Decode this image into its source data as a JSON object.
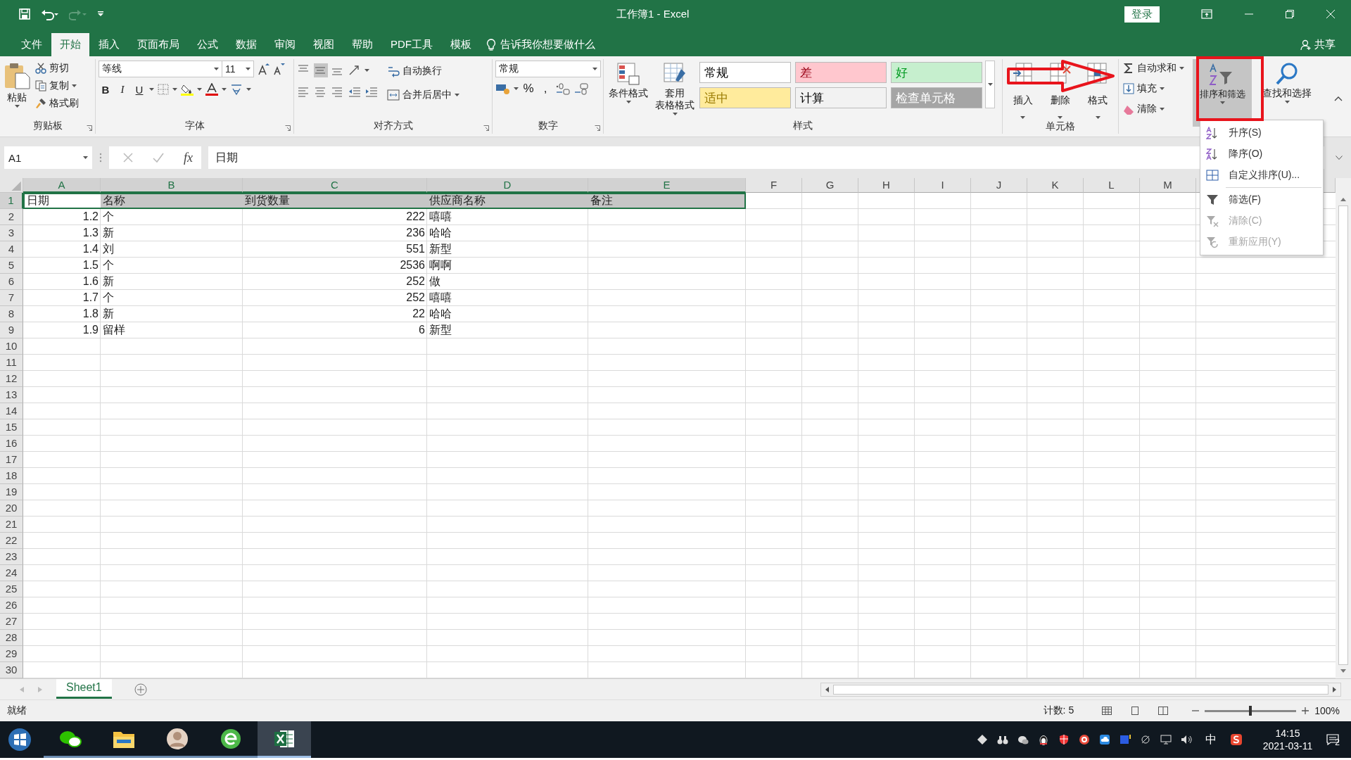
{
  "window": {
    "title": "工作簿1 - Excel",
    "login": "登录",
    "share": "共享"
  },
  "ribbon_tabs": [
    {
      "label": "文件",
      "selected": false
    },
    {
      "label": "开始",
      "selected": true
    },
    {
      "label": "插入",
      "selected": false
    },
    {
      "label": "页面布局",
      "selected": false
    },
    {
      "label": "公式",
      "selected": false
    },
    {
      "label": "数据",
      "selected": false
    },
    {
      "label": "审阅",
      "selected": false
    },
    {
      "label": "视图",
      "selected": false
    },
    {
      "label": "帮助",
      "selected": false
    },
    {
      "label": "PDF工具",
      "selected": false
    },
    {
      "label": "模板",
      "selected": false
    }
  ],
  "tell_me": "告诉我你想要做什么",
  "ribbon": {
    "clipboard": {
      "label": "剪贴板",
      "paste": "粘贴",
      "cut": "剪切",
      "copy": "复制",
      "format_painter": "格式刷"
    },
    "font": {
      "label": "字体",
      "font_name": "等线",
      "font_size": "11",
      "bold": "B",
      "italic": "I",
      "underline": "U"
    },
    "alignment": {
      "label": "对齐方式",
      "wrap_text": "自动换行",
      "merge_center": "合并后居中"
    },
    "number": {
      "label": "数字",
      "format": "常规",
      "percent": "%",
      "comma": ","
    },
    "styles": {
      "label": "样式",
      "conditional_formatting": "条件格式",
      "format_as_table": [
        "套用",
        "表格格式"
      ],
      "cell_styles": [
        {
          "label": "常规",
          "color": "#ffffff"
        },
        {
          "label": "差",
          "color": "#ffc7ce"
        },
        {
          "label": "好",
          "color": "#c6efce"
        },
        {
          "label": "适中",
          "color": "#ffeb9c"
        },
        {
          "label": "计算",
          "color": "#f2f2f2"
        },
        {
          "label": "检查单元格",
          "color": "#a5a5a5"
        }
      ]
    },
    "cells": {
      "label": "单元格",
      "insert": "插入",
      "delete": "删除",
      "format": "格式"
    },
    "editing": {
      "autosum": "自动求和",
      "fill": "填充",
      "clear": "清除",
      "sort_filter": {
        "label": "排序和筛选",
        "selected": true
      },
      "find_select": "查找和选择"
    }
  },
  "formula_bar": {
    "name_box": "A1",
    "fx": "fx",
    "formula": "日期"
  },
  "sheet": {
    "columns": [
      {
        "label": "A",
        "selected": true
      },
      {
        "label": "B",
        "selected": true
      },
      {
        "label": "C",
        "selected": true
      },
      {
        "label": "D",
        "selected": true
      },
      {
        "label": "E",
        "selected": true
      },
      {
        "label": "F",
        "selected": false
      },
      {
        "label": "G",
        "selected": false
      },
      {
        "label": "H",
        "selected": false
      },
      {
        "label": "I",
        "selected": false
      },
      {
        "label": "J",
        "selected": false
      },
      {
        "label": "K",
        "selected": false
      },
      {
        "label": "L",
        "selected": false
      },
      {
        "label": "M",
        "selected": false
      }
    ],
    "rows": [
      {
        "number": "1",
        "selected": true,
        "cells": [
          {
            "text": "日期",
            "kind": "text"
          },
          {
            "text": "名称",
            "kind": "text"
          },
          {
            "text": "到货数量",
            "kind": "text"
          },
          {
            "text": "供应商名称",
            "kind": "text"
          },
          {
            "text": "备注",
            "kind": "text"
          }
        ]
      },
      {
        "number": "2",
        "selected": false,
        "cells": [
          {
            "text": "1.2",
            "kind": "number"
          },
          {
            "text": "个",
            "kind": "text"
          },
          {
            "text": "222",
            "kind": "number"
          },
          {
            "text": "嘻嘻",
            "kind": "text"
          }
        ]
      },
      {
        "number": "3",
        "selected": false,
        "cells": [
          {
            "text": "1.3",
            "kind": "number"
          },
          {
            "text": "新",
            "kind": "text"
          },
          {
            "text": "236",
            "kind": "number"
          },
          {
            "text": "哈哈",
            "kind": "text"
          }
        ]
      },
      {
        "number": "4",
        "selected": false,
        "cells": [
          {
            "text": "1.4",
            "kind": "number"
          },
          {
            "text": "刘",
            "kind": "text"
          },
          {
            "text": "551",
            "kind": "number"
          },
          {
            "text": "新型",
            "kind": "text"
          }
        ]
      },
      {
        "number": "5",
        "selected": false,
        "cells": [
          {
            "text": "1.5",
            "kind": "number"
          },
          {
            "text": "个",
            "kind": "text"
          },
          {
            "text": "2536",
            "kind": "number"
          },
          {
            "text": "啊啊",
            "kind": "text"
          }
        ]
      },
      {
        "number": "6",
        "selected": false,
        "cells": [
          {
            "text": "1.6",
            "kind": "number"
          },
          {
            "text": "新",
            "kind": "text"
          },
          {
            "text": "252",
            "kind": "number"
          },
          {
            "text": "做",
            "kind": "text"
          }
        ]
      },
      {
        "number": "7",
        "selected": false,
        "cells": [
          {
            "text": "1.7",
            "kind": "number"
          },
          {
            "text": "个",
            "kind": "text"
          },
          {
            "text": "252",
            "kind": "number"
          },
          {
            "text": "嘻嘻",
            "kind": "text"
          }
        ]
      },
      {
        "number": "8",
        "selected": false,
        "cells": [
          {
            "text": "1.8",
            "kind": "number"
          },
          {
            "text": "新",
            "kind": "text"
          },
          {
            "text": "22",
            "kind": "number"
          },
          {
            "text": "哈哈",
            "kind": "text"
          }
        ]
      },
      {
        "number": "9",
        "selected": false,
        "cells": [
          {
            "text": "1.9",
            "kind": "number"
          },
          {
            "text": "留样",
            "kind": "text"
          },
          {
            "text": "6",
            "kind": "number"
          },
          {
            "text": "新型",
            "kind": "text"
          }
        ]
      },
      {
        "number": "10",
        "selected": false,
        "cells": []
      },
      {
        "number": "11",
        "selected": false,
        "cells": []
      },
      {
        "number": "12",
        "selected": false,
        "cells": []
      },
      {
        "number": "13",
        "selected": false,
        "cells": []
      },
      {
        "number": "14",
        "selected": false,
        "cells": []
      },
      {
        "number": "15",
        "selected": false,
        "cells": []
      },
      {
        "number": "16",
        "selected": false,
        "cells": []
      },
      {
        "number": "17",
        "selected": false,
        "cells": []
      },
      {
        "number": "18",
        "selected": false,
        "cells": []
      },
      {
        "number": "19",
        "selected": false,
        "cells": []
      },
      {
        "number": "20",
        "selected": false,
        "cells": []
      },
      {
        "number": "21",
        "selected": false,
        "cells": []
      },
      {
        "number": "22",
        "selected": false,
        "cells": []
      },
      {
        "number": "23",
        "selected": false,
        "cells": []
      },
      {
        "number": "24",
        "selected": false,
        "cells": []
      },
      {
        "number": "25",
        "selected": false,
        "cells": []
      },
      {
        "number": "26",
        "selected": false,
        "cells": []
      },
      {
        "number": "27",
        "selected": false,
        "cells": []
      },
      {
        "number": "28",
        "selected": false,
        "cells": []
      },
      {
        "number": "29",
        "selected": false,
        "cells": []
      },
      {
        "number": "30",
        "selected": false,
        "cells": []
      }
    ]
  },
  "sheet_tabs": [
    {
      "label": "Sheet1",
      "selected": true
    }
  ],
  "status_bar": {
    "ready": "就绪",
    "count": "计数: 5",
    "zoom_slider": {
      "level": 0.5
    },
    "zoom": "100%"
  },
  "sort_menu": [
    {
      "label": "升序(S)",
      "disabled": false,
      "separator_before": false
    },
    {
      "label": "降序(O)",
      "disabled": false,
      "separator_before": false
    },
    {
      "label": "自定义排序(U)...",
      "disabled": false,
      "separator_before": false
    },
    {
      "label": "筛选(F)",
      "disabled": false,
      "separator_before": true
    },
    {
      "label": "清除(C)",
      "disabled": true,
      "separator_before": false
    },
    {
      "label": "重新应用(Y)",
      "disabled": true,
      "separator_before": false
    }
  ],
  "taskbar": {
    "apps": [
      {
        "kind": "chat",
        "selected": false
      },
      {
        "kind": "folder",
        "selected": false
      },
      {
        "kind": "avatar",
        "selected": false
      },
      {
        "kind": "browser",
        "selected": false
      },
      {
        "kind": "spreadsheet",
        "selected": true
      }
    ],
    "ime": "中",
    "time": "14:15",
    "date": "2021-03-11",
    "notifications": "2"
  }
}
